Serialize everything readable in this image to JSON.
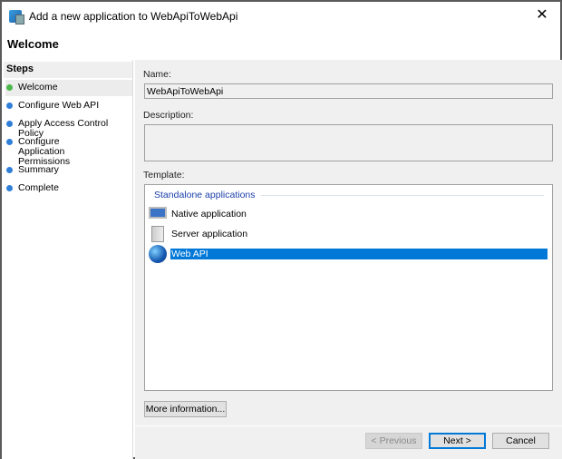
{
  "window": {
    "title": "Add a new application to WebApiToWebApi",
    "close_icon": "close-icon"
  },
  "header": {
    "title": "Welcome"
  },
  "steps": {
    "heading": "Steps",
    "items": [
      {
        "label": "Welcome",
        "status": "current",
        "color": "#4cb84c"
      },
      {
        "label": "Configure Web API",
        "status": "pending",
        "color": "#2f7fd8"
      },
      {
        "label": "Apply Access Control Policy",
        "status": "pending",
        "color": "#2f7fd8"
      },
      {
        "label": "Configure Application Permissions",
        "status": "pending",
        "color": "#2f7fd8"
      },
      {
        "label": "Summary",
        "status": "pending",
        "color": "#2f7fd8"
      },
      {
        "label": "Complete",
        "status": "pending",
        "color": "#2f7fd8"
      }
    ]
  },
  "form": {
    "name_label": "Name:",
    "name_value": "WebApiToWebApi",
    "description_label": "Description:",
    "description_value": "",
    "template_label": "Template:",
    "template_group": "Standalone applications",
    "templates": [
      {
        "label": "Native application",
        "icon": "monitor-icon"
      },
      {
        "label": "Server application",
        "icon": "server-icon"
      },
      {
        "label": "Web API",
        "icon": "globe-icon",
        "selected": true
      }
    ]
  },
  "buttons": {
    "more_info": "More information...",
    "previous": "< Previous",
    "next": "Next >",
    "cancel": "Cancel"
  },
  "colors": {
    "selection": "#0078d7",
    "group_header": "#1a3ea8"
  }
}
